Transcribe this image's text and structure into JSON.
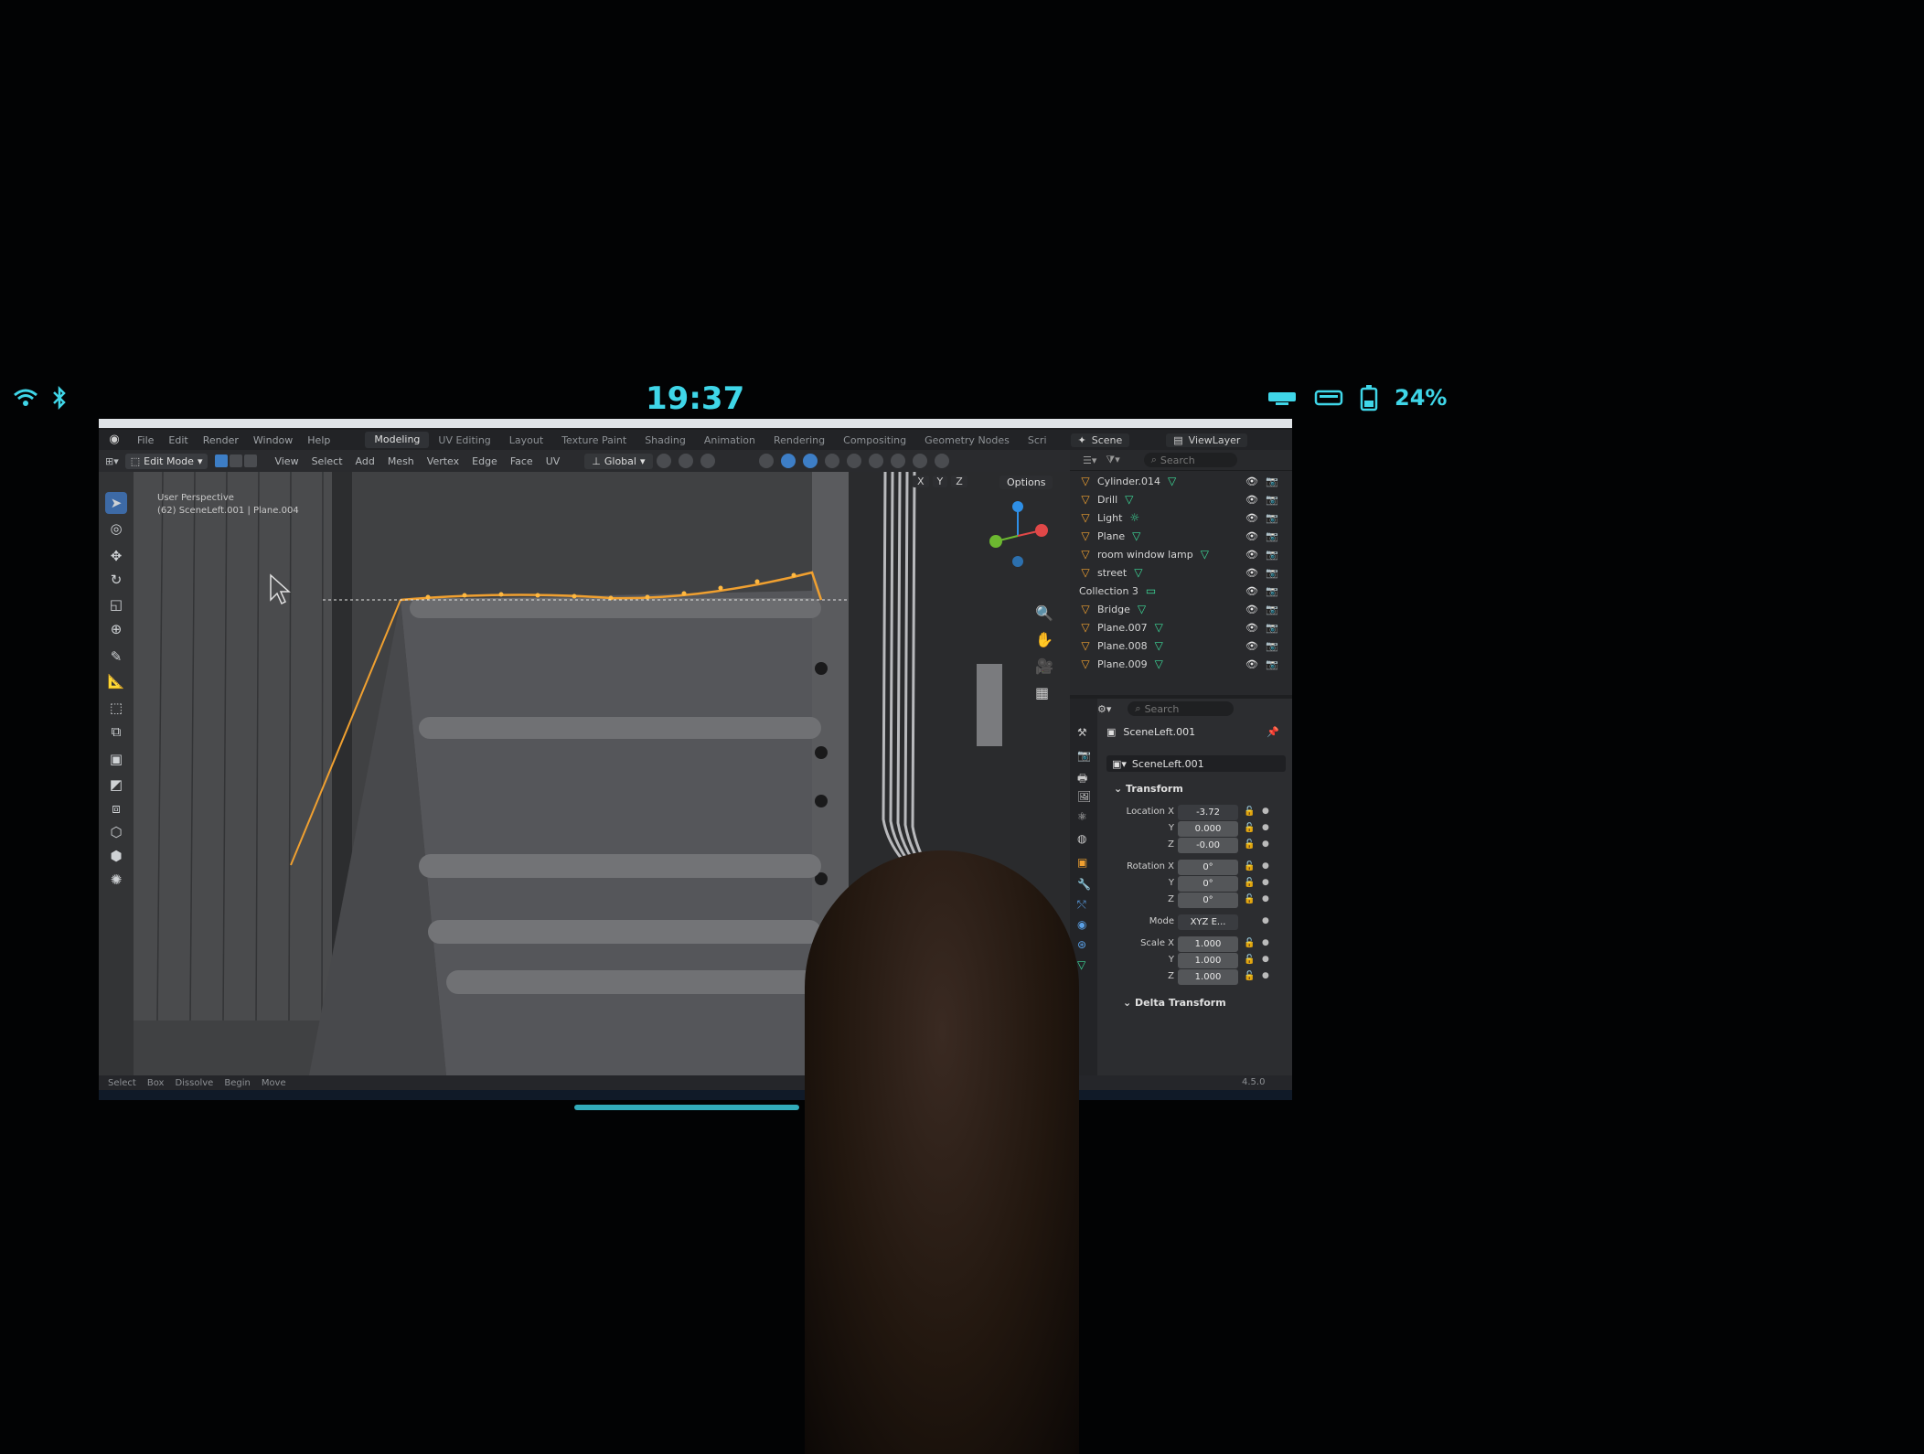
{
  "status_bar": {
    "time": "19:37",
    "battery": "24%"
  },
  "menubar": {
    "items": [
      "File",
      "Edit",
      "Render",
      "Window",
      "Help"
    ],
    "workspaces": [
      "Modeling",
      "UV Editing",
      "Layout",
      "Texture Paint",
      "Shading",
      "Animation",
      "Rendering",
      "Compositing",
      "Geometry Nodes",
      "Scri"
    ],
    "active_workspace": "Modeling",
    "scene": "Scene",
    "view_layer": "ViewLayer"
  },
  "header": {
    "mode": "Edit Mode",
    "menus": [
      "View",
      "Select",
      "Add",
      "Mesh",
      "Vertex",
      "Edge",
      "Face",
      "UV"
    ],
    "orientation": "Global",
    "options": "Options"
  },
  "viewport": {
    "perspective": "User Perspective",
    "object_info": "(62) SceneLeft.001 | Plane.004",
    "axes": [
      "X",
      "Y",
      "Z"
    ]
  },
  "outliner": {
    "search_placeholder": "Search",
    "rows": [
      {
        "name": "Cylinder.014",
        "icon": "mesh-object-icon",
        "kind": "object"
      },
      {
        "name": "Drill",
        "icon": "mesh-object-icon",
        "kind": "object"
      },
      {
        "name": "Light",
        "icon": "light-object-icon",
        "kind": "object"
      },
      {
        "name": "Plane",
        "icon": "mesh-object-icon",
        "kind": "object"
      },
      {
        "name": "room window lamp",
        "icon": "mesh-object-icon",
        "kind": "object"
      },
      {
        "name": "street",
        "icon": "mesh-object-icon",
        "kind": "object"
      },
      {
        "name": "Collection 3",
        "icon": "collection-icon",
        "kind": "collection"
      },
      {
        "name": "Bridge",
        "icon": "mesh-object-icon",
        "kind": "object"
      },
      {
        "name": "Plane.007",
        "icon": "mesh-object-icon",
        "kind": "object"
      },
      {
        "name": "Plane.008",
        "icon": "mesh-object-icon",
        "kind": "object"
      },
      {
        "name": "Plane.009",
        "icon": "mesh-object-icon",
        "kind": "object"
      }
    ]
  },
  "properties": {
    "search_placeholder": "Search",
    "object_name": "SceneLeft.001",
    "data_name": "SceneLeft.001",
    "transform_title": "Transform",
    "location_label": "Location X",
    "rotation_label": "Rotation X",
    "scale_label": "Scale X",
    "y_label": "Y",
    "z_label": "Z",
    "mode_label": "Mode",
    "location": {
      "x": "-3.72",
      "y": "0.000",
      "z": "-0.00"
    },
    "rotation": {
      "x": "0°",
      "y": "0°",
      "z": "0°"
    },
    "rotation_mode": "XYZ E...",
    "scale": {
      "x": "1.000",
      "y": "1.000",
      "z": "1.000"
    },
    "delta_title": "Delta Transform"
  },
  "statusline": {
    "items": [
      "Select",
      "Box",
      "Dissolve",
      "Begin",
      "Move"
    ],
    "version": "4.5.0"
  },
  "colors": {
    "accent": "#3fd6e8",
    "selection": "#f0a030",
    "active_tool": "#3d6aa6"
  }
}
